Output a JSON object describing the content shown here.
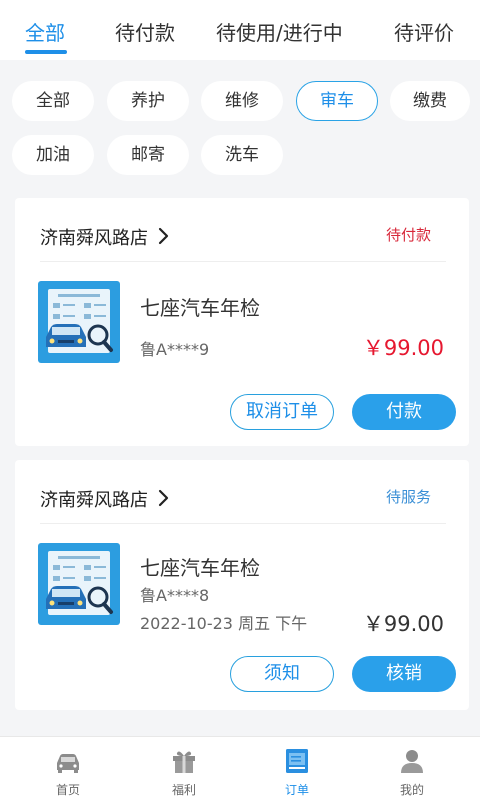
{
  "tabs": [
    {
      "label": "全部",
      "active": true
    },
    {
      "label": "待付款",
      "active": false
    },
    {
      "label": "待使用/进行中",
      "active": false
    },
    {
      "label": "待评价",
      "active": false
    }
  ],
  "filters": [
    {
      "label": "全部",
      "active": false
    },
    {
      "label": "养护",
      "active": false
    },
    {
      "label": "维修",
      "active": false
    },
    {
      "label": "审车",
      "active": true
    },
    {
      "label": "缴费",
      "active": false
    },
    {
      "label": "加油",
      "active": false
    },
    {
      "label": "邮寄",
      "active": false
    },
    {
      "label": "洗车",
      "active": false
    }
  ],
  "orders": [
    {
      "store": "济南舜风路店",
      "status": "待付款",
      "title": "七座汽车年检",
      "plate": "鲁A****9",
      "price": "￥99.00",
      "buttons": {
        "secondary": "取消订单",
        "primary": "付款"
      }
    },
    {
      "store": "济南舜风路店",
      "status": "待服务",
      "title": "七座汽车年检",
      "plate": "鲁A****8",
      "datetime": "2022-10-23 周五 下午",
      "price": "￥99.00",
      "buttons": {
        "secondary": "须知",
        "primary": "核销"
      }
    }
  ],
  "nav": [
    {
      "label": "首页",
      "icon": "car-icon",
      "active": false
    },
    {
      "label": "福利",
      "icon": "gift-icon",
      "active": false
    },
    {
      "label": "订单",
      "icon": "order-icon",
      "active": true
    },
    {
      "label": "我的",
      "icon": "user-icon",
      "active": false
    }
  ],
  "colors": {
    "accent": "#1e8fe8",
    "price_red": "#e6172f",
    "status_red": "#d8283a"
  }
}
